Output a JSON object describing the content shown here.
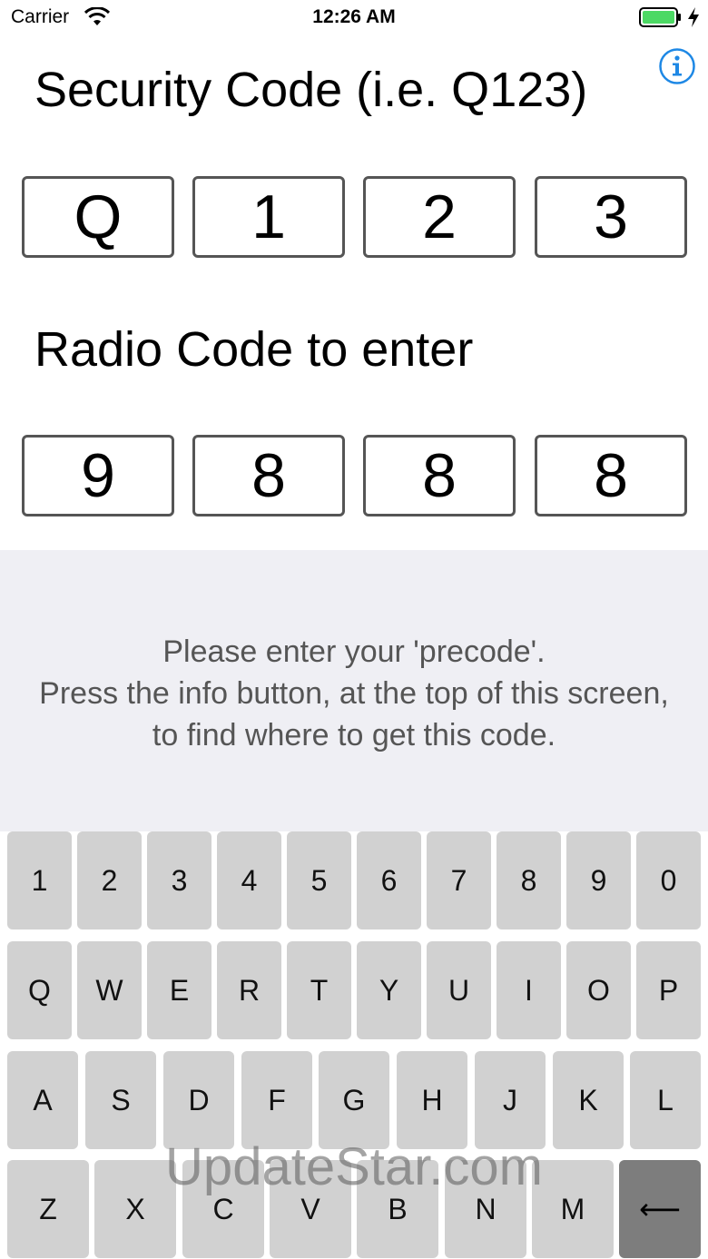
{
  "status_bar": {
    "carrier": "Carrier",
    "time": "12:26 AM",
    "battery_color": "#4cd964"
  },
  "header": {
    "info_icon": "info-icon",
    "accent_color": "#1e88e5"
  },
  "security": {
    "title": "Security Code (i.e. Q123)",
    "chars": [
      "Q",
      "1",
      "2",
      "3"
    ]
  },
  "radio": {
    "title": "Radio Code to enter",
    "digits": [
      "9",
      "8",
      "8",
      "8"
    ]
  },
  "message": {
    "line1": "Please enter your 'precode'.",
    "line2": "Press the info button, at the top of this screen,",
    "line3": "to find where to get this code."
  },
  "keyboard": {
    "row1": [
      "1",
      "2",
      "3",
      "4",
      "5",
      "6",
      "7",
      "8",
      "9",
      "0"
    ],
    "row2": [
      "Q",
      "W",
      "E",
      "R",
      "T",
      "Y",
      "U",
      "I",
      "O",
      "P"
    ],
    "row3": [
      "A",
      "S",
      "D",
      "F",
      "G",
      "H",
      "J",
      "K",
      "L"
    ],
    "row4": [
      "Z",
      "X",
      "C",
      "V",
      "B",
      "N",
      "M"
    ],
    "backspace": "⟵"
  },
  "watermark": "UpdateStar.com"
}
